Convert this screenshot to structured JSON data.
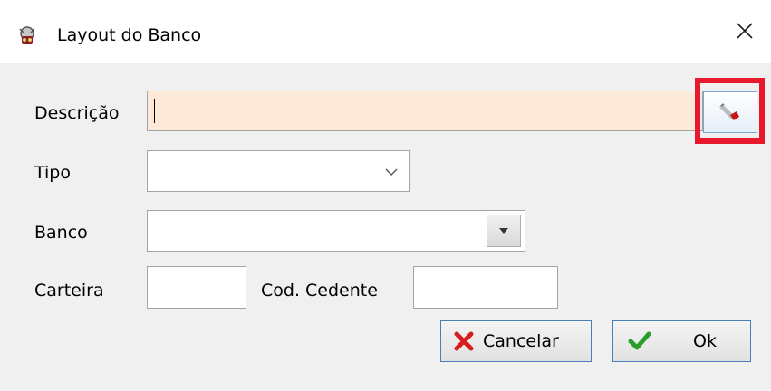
{
  "window": {
    "title": "Layout do Banco",
    "icon": "app-icon",
    "close_glyph": "✕"
  },
  "form": {
    "descricao": {
      "label": "Descrição",
      "value": "",
      "bg_color": "#fde9d7"
    },
    "tipo": {
      "label": "Tipo",
      "value": "",
      "chevron": "chevron-down-icon"
    },
    "banco": {
      "label": "Banco",
      "value": "",
      "dropdown": "dropdown-arrow-icon"
    },
    "carteira": {
      "label": "Carteira",
      "value": ""
    },
    "cod_cedente": {
      "label": "Cod. Cedente",
      "value": ""
    }
  },
  "buttons": {
    "lookup_icon": "eraser-icon",
    "cancelar": {
      "label": "Cancelar",
      "icon": "x-icon",
      "icon_color": "#d81d1d"
    },
    "ok": {
      "label": "Ok",
      "icon": "check-icon",
      "icon_color": "#2a9d2a"
    }
  },
  "highlight_color": "#e8192c"
}
